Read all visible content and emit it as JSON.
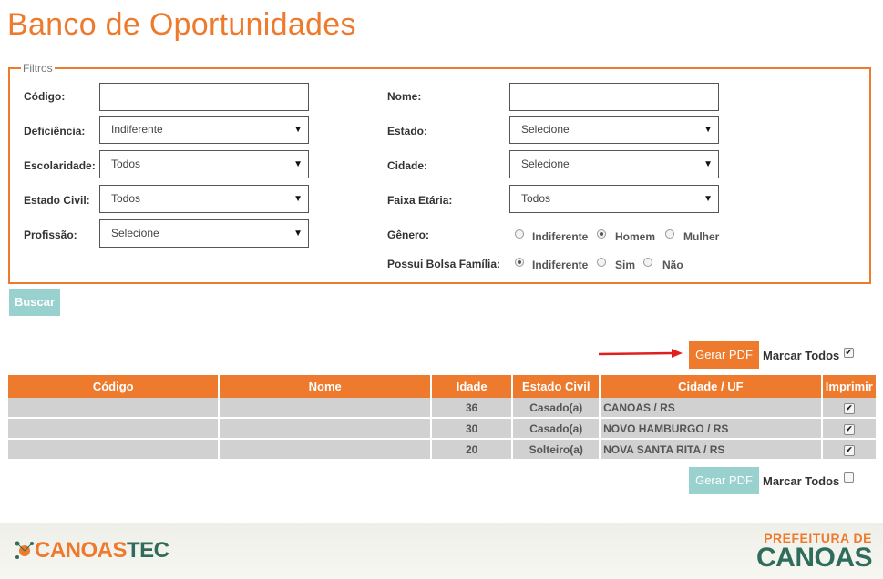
{
  "page": {
    "title": "Banco de Oportunidades"
  },
  "filters": {
    "legend": "Filtros",
    "codigo_label": "Código:",
    "codigo_value": "",
    "deficiencia_label": "Deficiência:",
    "deficiencia_value": "Indiferente",
    "escolaridade_label": "Escolaridade:",
    "escolaridade_value": "Todos",
    "estado_civil_label": "Estado Civil:",
    "estado_civil_value": "Todos",
    "profissao_label": "Profissão:",
    "profissao_value": "Selecione",
    "nome_label": "Nome:",
    "nome_value": "",
    "estado_label": "Estado:",
    "estado_value": "Selecione",
    "cidade_label": "Cidade:",
    "cidade_value": "Selecione",
    "faixa_label": "Faixa Etária:",
    "faixa_value": "Todos",
    "genero_label": "Gênero:",
    "genero_options": [
      "Indiferente",
      "Homem",
      "Mulher"
    ],
    "genero_selected": "Homem",
    "bolsa_label": "Possui Bolsa Família:",
    "bolsa_options": [
      "Indiferente",
      "Sim",
      "Não"
    ],
    "bolsa_selected": "Indiferente"
  },
  "buttons": {
    "buscar": "Buscar",
    "gerar_pdf": "Gerar PDF",
    "marcar_todos": "Marcar Todos"
  },
  "table": {
    "headers": [
      "Código",
      "Nome",
      "Idade",
      "Estado Civil",
      "Cidade / UF",
      "Imprimir"
    ],
    "rows": [
      {
        "codigo": "",
        "nome": "",
        "idade": "36",
        "estado_civil": "Casado(a)",
        "cidade": "CANOAS / RS",
        "imprimir": true
      },
      {
        "codigo": "",
        "nome": "",
        "idade": "30",
        "estado_civil": "Casado(a)",
        "cidade": "NOVO HAMBURGO / RS",
        "imprimir": true
      },
      {
        "codigo": "",
        "nome": "",
        "idade": "20",
        "estado_civil": "Solteiro(a)",
        "cidade": "NOVA SANTA RITA / RS",
        "imprimir": true
      }
    ]
  },
  "marcar_todos_top_checked": true,
  "marcar_todos_bottom_checked": false,
  "footer": {
    "logo_left_a": "CANOAS",
    "logo_left_b": "TEC",
    "logo_right_top": "PREFEITURA DE",
    "logo_right_bottom": "CANOAS"
  },
  "colors": {
    "accent": "#ee7a2e",
    "teal": "#99d1cf",
    "row_bg": "#d1d1d1"
  }
}
